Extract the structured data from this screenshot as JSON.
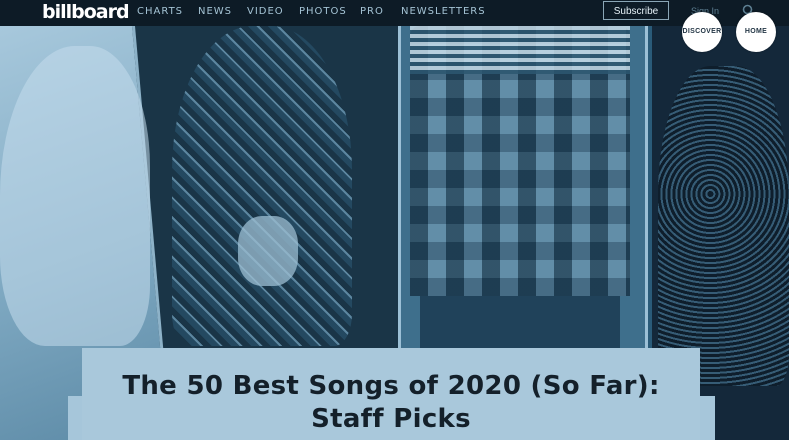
{
  "brand": {
    "logo_text": "billboard"
  },
  "nav": {
    "items": [
      {
        "label": "CHARTS"
      },
      {
        "label": "NEWS"
      },
      {
        "label": "VIDEO"
      },
      {
        "label": "PHOTOS"
      },
      {
        "label": "PRO"
      },
      {
        "label": "NEWSLETTERS"
      }
    ],
    "subscribe_label": "Subscribe",
    "signin_label": "Sign In",
    "search_icon": "search-icon"
  },
  "floating_buttons": {
    "discover_label": "DISCOVER",
    "home_label": "HOME"
  },
  "article": {
    "headline_line1": "The 50 Best Songs of 2020 (So Far):",
    "headline_line2": "Staff Picks"
  },
  "colors": {
    "topbar": "#0d1b26",
    "hero_tint": "#2a5b79",
    "headline_card": "#a9c8db",
    "headline_text": "#14202a"
  }
}
